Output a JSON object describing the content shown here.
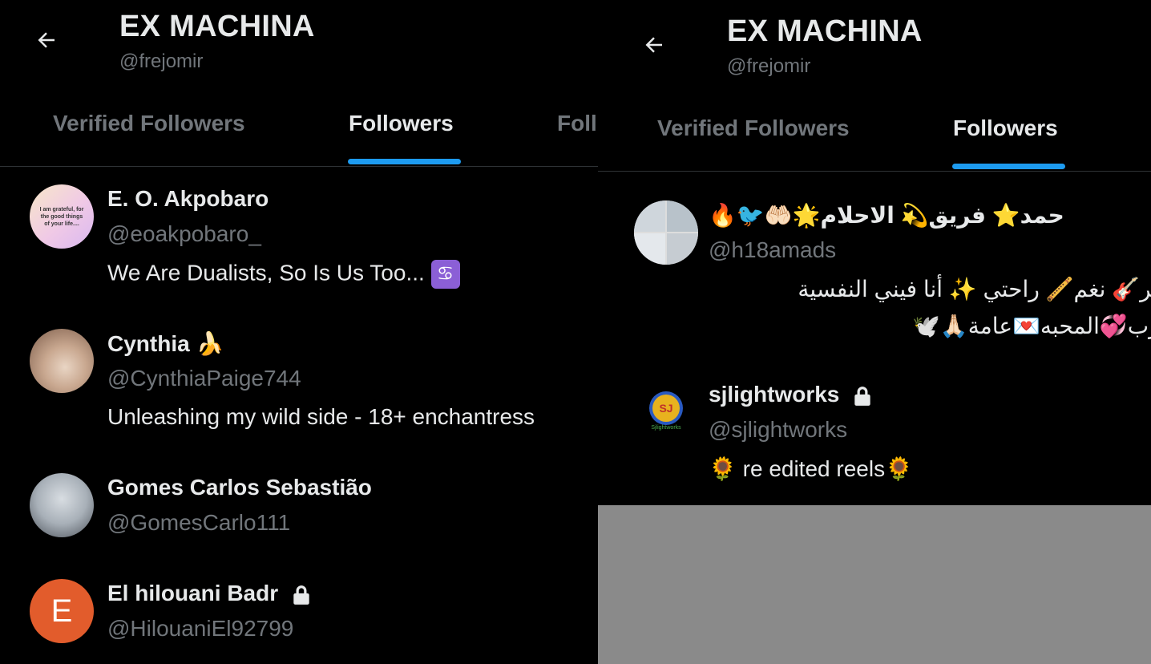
{
  "left_panel": {
    "header": {
      "title": "EX MACHINA",
      "handle": "@frejomir"
    },
    "tabs": [
      {
        "label": "Verified Followers",
        "active": false
      },
      {
        "label": "Followers",
        "active": true
      },
      {
        "label": "Foll",
        "active": false
      }
    ],
    "followers": [
      {
        "name": "E. O. Akpobaro",
        "handle": "@eoakpobaro_",
        "bio": "We Are Dualists, So Is Us Too...",
        "bio_emoji": "♋",
        "avatar_text": "I am grateful, for the good things of your life....",
        "locked": false
      },
      {
        "name": "Cynthia 🍌",
        "handle": "@CynthiaPaige744",
        "bio": "Unleashing my wild side - 18+ enchantress",
        "locked": false
      },
      {
        "name": "Gomes Carlos Sebastião",
        "handle": "@GomesCarlo111",
        "bio": "",
        "locked": false
      },
      {
        "name": "El hilouani Badr",
        "handle": "@HilouaniEl92799",
        "bio": "",
        "avatar_letter": "E",
        "locked": true
      }
    ]
  },
  "right_panel": {
    "header": {
      "title": "EX MACHINA",
      "handle": "@frejomir"
    },
    "tabs": [
      {
        "label": "Verified Followers",
        "active": false
      },
      {
        "label": "Followers",
        "active": true
      }
    ],
    "followers": [
      {
        "name": "🔥🐦🤲🏻🌟حمد⭐ فريق💫 الاحلام",
        "handle": "@h18amads",
        "bio_line1": "الأساطير🎸 نغم🪈 راحتي ✨ أنا فيني النفسية",
        "bio_line2": "🎶درب💞المحبه💌عامة🙏🏻🕊️",
        "locked": false
      },
      {
        "name": "sjlightworks",
        "handle": "@sjlightworks",
        "bio": "🌻 re edited reels🌻",
        "avatar_text": "SJ",
        "avatar_caption": "Sjlightworks",
        "locked": true
      }
    ]
  },
  "colors": {
    "background": "#000000",
    "accent": "#1d9bf0",
    "muted_text": "#71767b",
    "primary_text": "#e7e9ea",
    "divider": "#2f3336",
    "letter_avatar": "#e25c2c",
    "outside": "#8a8a8a"
  },
  "icons": [
    "back-arrow-icon",
    "lock-icon"
  ]
}
